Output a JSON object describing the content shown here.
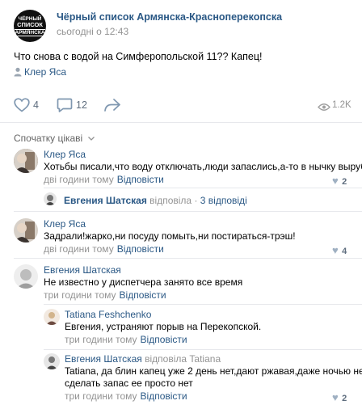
{
  "post": {
    "group_logo": {
      "line1": "ЧЁРНЫЙ",
      "line2": "СПИСОК",
      "line3": "АРМЯНСКА"
    },
    "group_name": "Чёрный список Армянска-Красноперекопска",
    "time": "сьогодні о 12:43",
    "text": "Что снова с водой на Симферопольской 11?? Капец!",
    "signer": "Клер Яса",
    "likes": "4",
    "comments": "12",
    "views": "1.2K"
  },
  "comments_header": {
    "sort_label": "Спочатку цікаві"
  },
  "comments": [
    {
      "author": "Клер Яса",
      "text": "Хотьбы писали,что воду отключать,люди запаслись,а-то в нычку вырубят.",
      "time": "дві години тому",
      "reply": "Відповісти",
      "likes": "2"
    },
    {
      "author": "Клер Яса",
      "text": "Задрали!жарко,ни посуду помыть,ни постираться-трэш!",
      "time": "дві години тому",
      "reply": "Відповісти",
      "likes": "4"
    },
    {
      "author": "Евгения Шатская",
      "text": "Не известно у диспетчера занято все время",
      "time": "три години тому",
      "reply": "Відповісти",
      "likes": ""
    }
  ],
  "thread1": {
    "author": "Евгения Шатская",
    "verb": "відповіла",
    "count": "3 відповіді"
  },
  "replies": [
    {
      "author": "Tatiana Feshchenko",
      "verb": "",
      "target": "",
      "text": "Евгения, устраняют порыв на Перекопской.",
      "time": "три години тому",
      "reply": "Відповісти",
      "likes": ""
    },
    {
      "author": "Евгения Шатская",
      "verb": "відповіла",
      "target": "Tatiana",
      "text_line1": "Tatiana, да блин капец уже 2 день нет,дают ржавая,даже ночью не",
      "text_line2": "сделать запас ее просто нет",
      "time": "три години тому",
      "reply": "Відповісти",
      "likes": "2"
    }
  ]
}
